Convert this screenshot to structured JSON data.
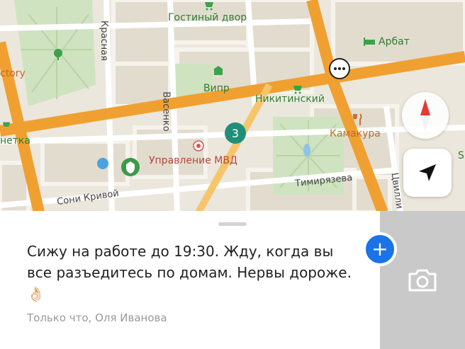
{
  "map": {
    "places": {
      "gostiny_dvor": "Гостиный двор",
      "arbat": "Арбат",
      "vipr": "Випр",
      "nikitinsky": "Никитинский",
      "kamakura": "Камакура",
      "upravlenie_mvd": "Управление МВД",
      "ctory": "ctory",
      "netka": "нетка",
      "s_edge": "S"
    },
    "streets": {
      "krasnaya": "Красная",
      "vasenko": "Васенко",
      "soni_krivoy": "Сони Кривой",
      "timiryazeva": "Тимирязева",
      "tsvillinga": "Цвилли"
    },
    "colors": {
      "main_road": "#f0a030",
      "park": "#cfe3c0",
      "accent_blue": "#1a73e8",
      "compass_red": "#e53935"
    }
  },
  "comment": {
    "text": "Сижу на работе до 19:30. Жду, когда вы все разъедитесь по домам. Нервы дороже. 👌🏻",
    "meta": "Только что, Оля Иванова"
  },
  "actions": {
    "add": "+"
  },
  "icons": [
    "compass-icon",
    "locate-arrow-icon",
    "camera-icon",
    "chat-bubble-icon",
    "plus-icon"
  ]
}
